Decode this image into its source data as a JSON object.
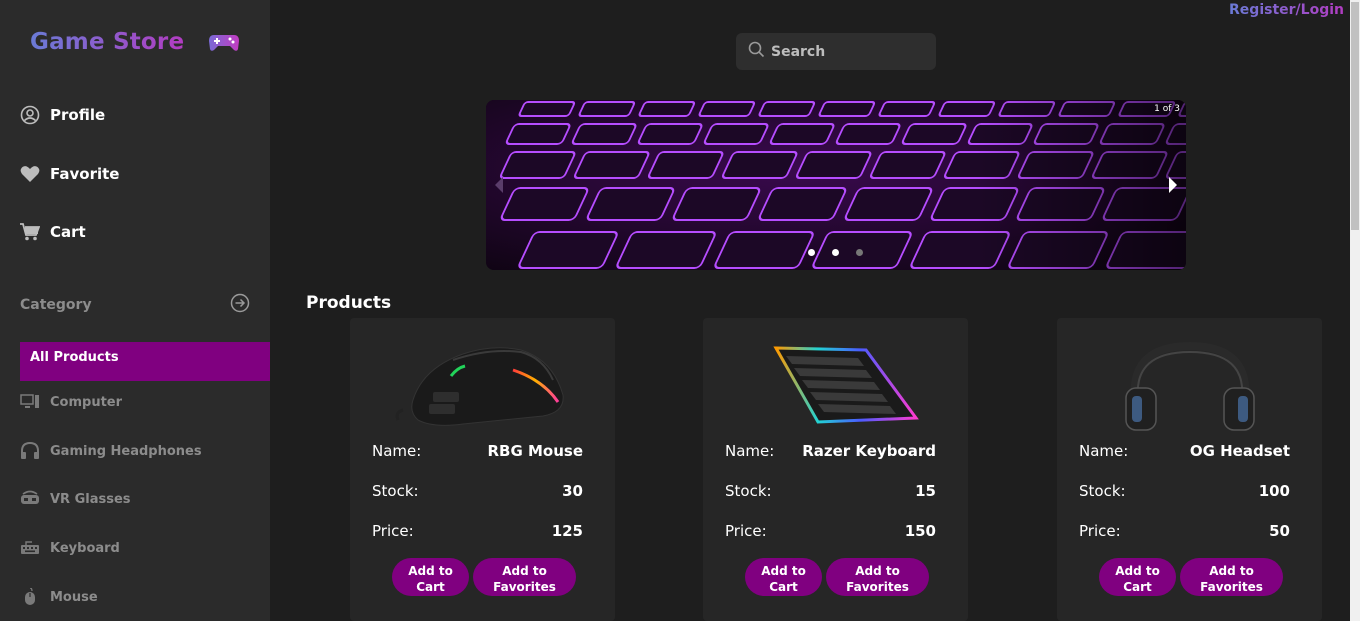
{
  "brand": {
    "name": "Game Store",
    "icon": "gamepad-icon"
  },
  "header": {
    "register_login": "Register/Login"
  },
  "search": {
    "placeholder": "Search"
  },
  "nav": [
    {
      "label": "Profile",
      "icon": "user-circle-icon"
    },
    {
      "label": "Favorite",
      "icon": "heart-icon"
    },
    {
      "label": "Cart",
      "icon": "cart-icon"
    }
  ],
  "category": {
    "heading": "Category",
    "active": "All Products",
    "items": [
      {
        "label": "Computer",
        "icon": "monitor-icon"
      },
      {
        "label": "Gaming Headphones",
        "icon": "headphones-icon"
      },
      {
        "label": "VR Glasses",
        "icon": "vr-icon"
      },
      {
        "label": "Keyboard",
        "icon": "keyboard-icon"
      },
      {
        "label": "Mouse",
        "icon": "mouse-icon"
      }
    ]
  },
  "carousel": {
    "counter": "1 of 3",
    "slides": 3,
    "active_slide": 1
  },
  "products": {
    "title": "Products",
    "labels": {
      "name": "Name:",
      "stock": "Stock:",
      "price": "Price:"
    },
    "add_to_cart": "Add to Cart",
    "add_to_favorites": "Add to Favorites",
    "items": [
      {
        "name": "RBG Mouse",
        "stock": "30",
        "price": "125",
        "image": "mouse"
      },
      {
        "name": "Razer Keyboard",
        "stock": "15",
        "price": "150",
        "image": "keyboard"
      },
      {
        "name": "OG Headset",
        "stock": "100",
        "price": "50",
        "image": "headset"
      }
    ]
  },
  "colors": {
    "accent": "#800080",
    "sidebar": "#2b2b2b",
    "background": "#1e1e1e",
    "brand_gradient_start": "#6a7bd6",
    "brand_gradient_end": "#b23cc2"
  }
}
